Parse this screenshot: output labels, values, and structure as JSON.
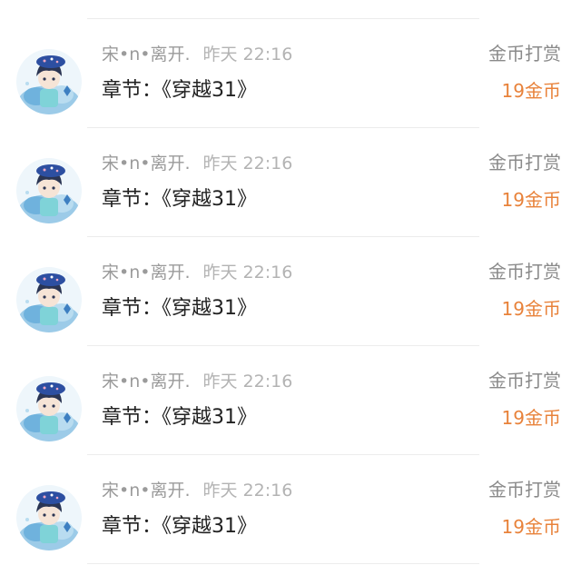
{
  "records": [
    {
      "user": "宋•n•离开.",
      "time": "昨天 22:16",
      "chapter": "章节：《穿越31》",
      "type": "金币打赏",
      "amount": "19金币"
    },
    {
      "user": "宋•n•离开.",
      "time": "昨天 22:16",
      "chapter": "章节：《穿越31》",
      "type": "金币打赏",
      "amount": "19金币"
    },
    {
      "user": "宋•n•离开.",
      "time": "昨天 22:16",
      "chapter": "章节：《穿越31》",
      "type": "金币打赏",
      "amount": "19金币"
    },
    {
      "user": "宋•n•离开.",
      "time": "昨天 22:16",
      "chapter": "章节：《穿越31》",
      "type": "金币打赏",
      "amount": "19金币"
    },
    {
      "user": "宋•n•离开.",
      "time": "昨天 22:16",
      "chapter": "章节：《穿越31》",
      "type": "金币打赏",
      "amount": "19金币"
    }
  ],
  "colors": {
    "amount": "#e8823a",
    "user": "#9b9b9b",
    "chapter": "#222222",
    "divider": "#ececec"
  },
  "icons": {
    "avatar": "avatar-icon"
  }
}
